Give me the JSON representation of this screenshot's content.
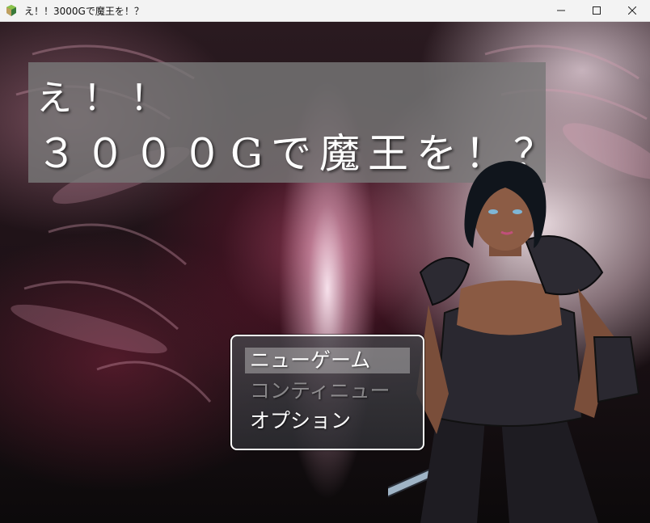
{
  "window": {
    "title": "え！！3000Gで魔王を！？",
    "controls": [
      "minimize-icon",
      "maximize-icon",
      "close-icon"
    ]
  },
  "game": {
    "title_line_1": "え！！",
    "title_line_2": "３０００Gで魔王を！？"
  },
  "menu": {
    "items": [
      {
        "label": "ニューゲーム",
        "state": "selected"
      },
      {
        "label": "コンティニュー",
        "state": "disabled"
      },
      {
        "label": "オプション",
        "state": "enabled"
      }
    ]
  },
  "colors": {
    "menu_border": "#ffffff",
    "selected_highlight": "#c8c8c8",
    "title_panel": "#787878"
  }
}
